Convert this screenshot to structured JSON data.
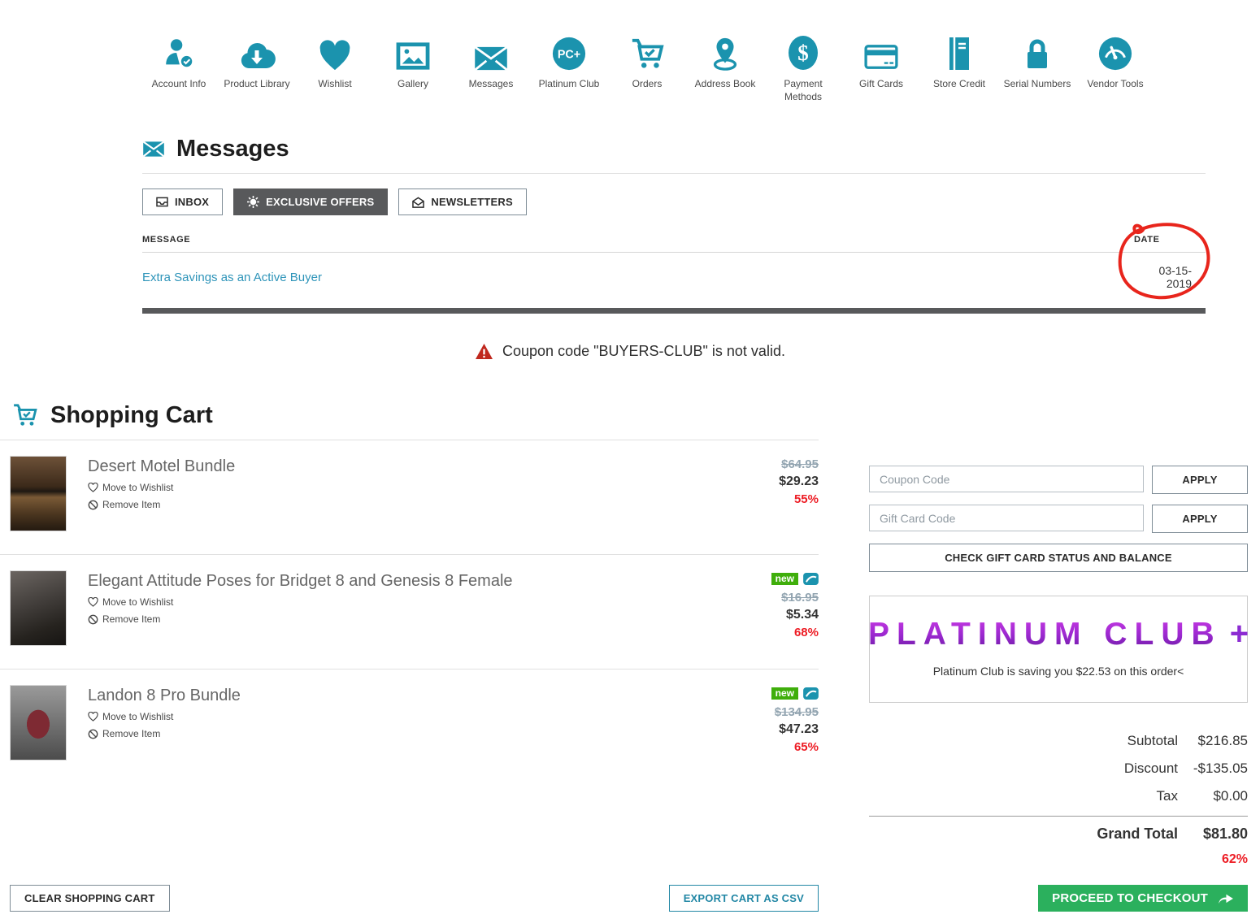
{
  "nav": {
    "platinum_icon_text": "PC+",
    "items": [
      {
        "label": "Account Info"
      },
      {
        "label": "Product Library"
      },
      {
        "label": "Wishlist"
      },
      {
        "label": "Gallery"
      },
      {
        "label": "Messages"
      },
      {
        "label": "Platinum Club"
      },
      {
        "label": "Orders"
      },
      {
        "label": "Address Book"
      },
      {
        "label": "Payment Methods"
      },
      {
        "label": "Gift Cards"
      },
      {
        "label": "Store Credit"
      },
      {
        "label": "Serial Numbers"
      },
      {
        "label": "Vendor Tools"
      }
    ]
  },
  "messages": {
    "title": "Messages",
    "tabs": [
      {
        "label": "INBOX",
        "active": false
      },
      {
        "label": "EXCLUSIVE OFFERS",
        "active": true
      },
      {
        "label": "NEWSLETTERS",
        "active": false
      }
    ],
    "columns": {
      "message": "MESSAGE",
      "date": "DATE"
    },
    "rows": [
      {
        "message": "Extra Savings as an Active Buyer",
        "date": "03-15-2019"
      }
    ]
  },
  "alert": {
    "text": "Coupon code \"BUYERS-CLUB\" is not valid."
  },
  "cart": {
    "title": "Shopping Cart",
    "wishlist_label": "Move to Wishlist",
    "remove_label": "Remove Item",
    "new_badge": "new",
    "items": [
      {
        "name": "Desert Motel Bundle",
        "old_price": "$64.95",
        "price": "$29.23",
        "discount": "55%",
        "new": false
      },
      {
        "name": "Elegant Attitude Poses for Bridget 8 and Genesis 8 Female",
        "old_price": "$16.95",
        "price": "$5.34",
        "discount": "68%",
        "new": true
      },
      {
        "name": "Landon 8 Pro Bundle",
        "old_price": "$134.95",
        "price": "$47.23",
        "discount": "65%",
        "new": true
      }
    ],
    "clear_button": "CLEAR SHOPPING CART",
    "export_button": "EXPORT CART AS CSV"
  },
  "sidebar": {
    "coupon_placeholder": "Coupon Code",
    "gift_placeholder": "Gift Card Code",
    "apply_label": "APPLY",
    "check_gift_label": "CHECK GIFT CARD STATUS AND BALANCE",
    "platinum": {
      "title": "PLATINUM CLUB",
      "plus": "+",
      "subtitle": "Platinum Club is saving you $22.53 on this order<"
    },
    "totals": [
      {
        "label": "Subtotal",
        "value": "$216.85"
      },
      {
        "label": "Discount",
        "value": "-$135.05"
      },
      {
        "label": "Tax",
        "value": "$0.00"
      }
    ],
    "grand_total": {
      "label": "Grand Total",
      "value": "$81.80"
    },
    "total_discount": "62%",
    "checkout_label": "PROCEED TO CHECKOUT"
  },
  "colors": {
    "accent_teal": "#1b93ae",
    "link_teal": "#2e94b9",
    "tab_active": "#58595b",
    "error_red": "#c0281e",
    "discount_red": "#ed1c24",
    "new_green": "#3fae0b",
    "checkout_green": "#2bb05d",
    "platinum_purple": "#9a28cf",
    "annotation_red": "#e8251c"
  }
}
